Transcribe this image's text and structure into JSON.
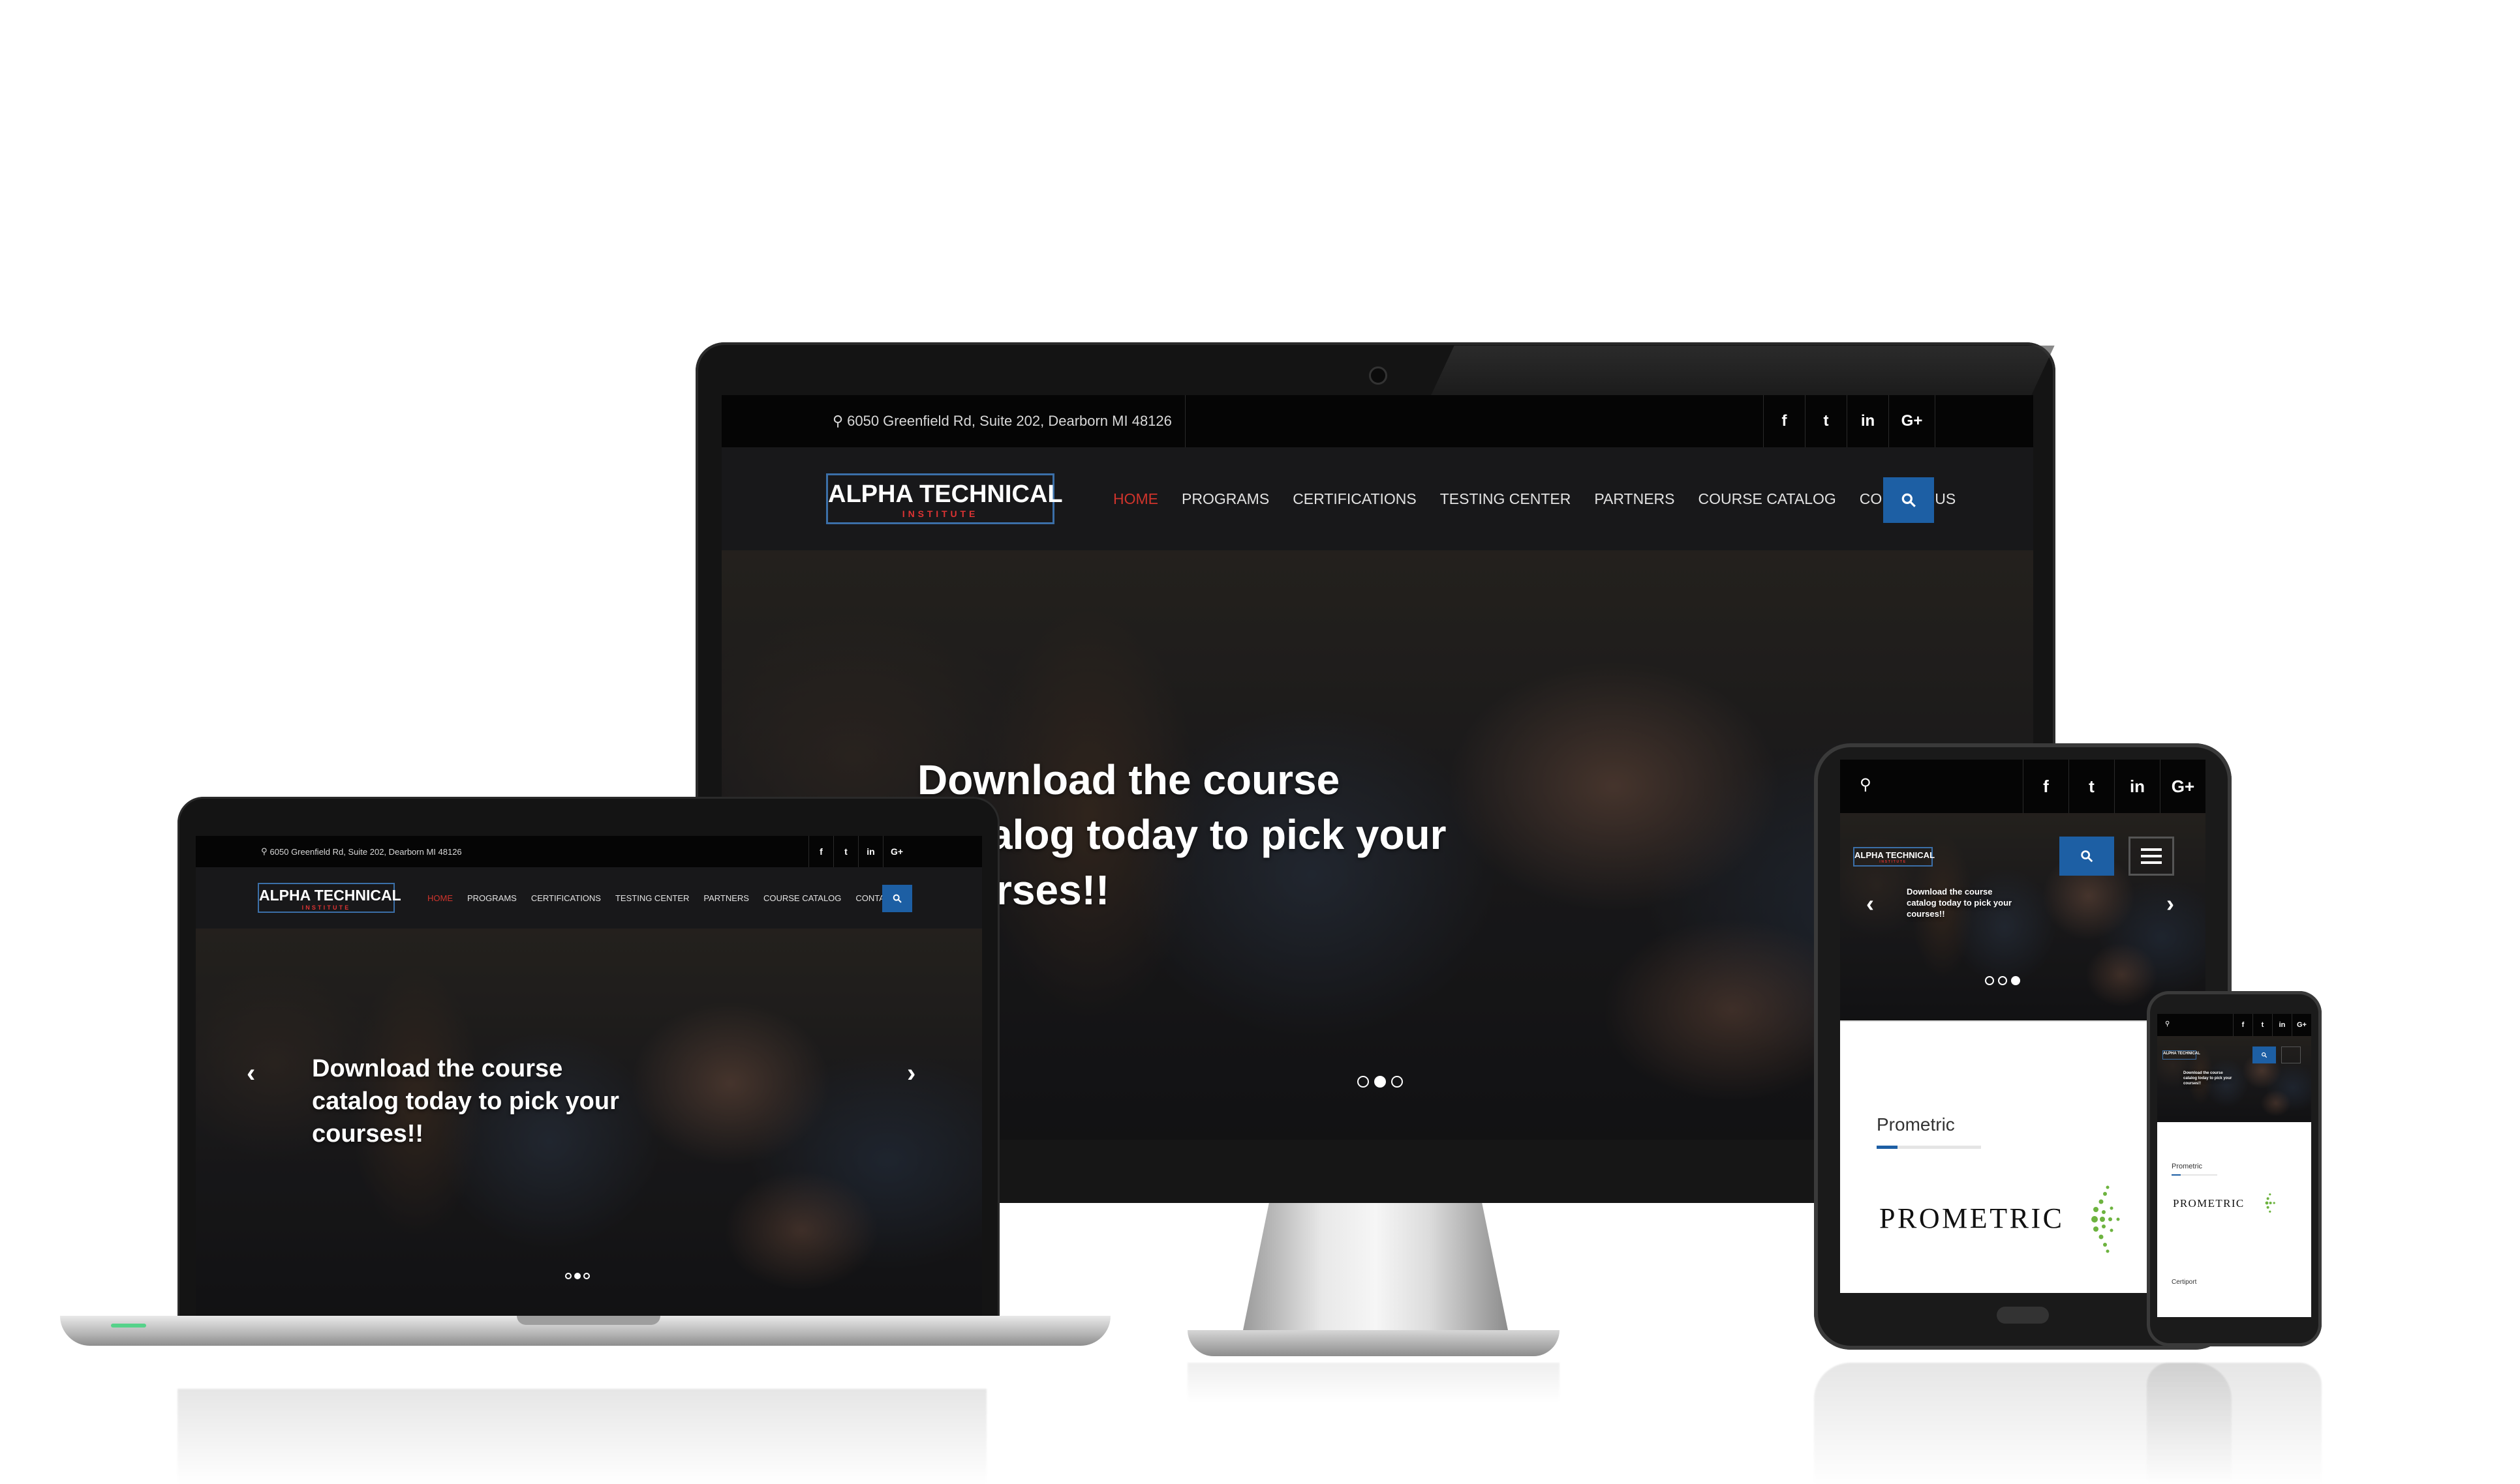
{
  "site": {
    "address": "6050 Greenfield Rd, Suite 202, Dearborn MI 48126",
    "logo_title": "ALPHA TECHNICAL",
    "logo_subtitle": "INSTITUTE",
    "nav": {
      "home": "HOME",
      "programs": "PROGRAMS",
      "certifications": "CERTIFICATIONS",
      "testing_center": "TESTING CENTER",
      "partners": "PARTNERS",
      "course_catalog": "COURSE CATALOG",
      "contact_us": "CONTACT US"
    },
    "social": {
      "facebook": "f",
      "twitter": "t",
      "linkedin": "in",
      "google": "G+"
    },
    "hero": {
      "monitor_line1": "Download the course",
      "monitor_line2": "alog today to pick your",
      "monitor_line3": "rses!!",
      "laptop_line1": "Download the course",
      "laptop_line2": "catalog today to pick your",
      "laptop_line3": "courses!!",
      "tablet_line1": "Download the course",
      "tablet_line2": "catalog today to pick your",
      "tablet_line3": "courses!!"
    },
    "partner_card": {
      "title": "Prometric",
      "logo_text": "PROMETRIC"
    },
    "phone_card": {
      "title": "Prometric",
      "logo_text": "PROMETRIC",
      "second_title": "Certiport"
    }
  },
  "icons": {
    "map_marker": "map-marker-icon",
    "search": "search-icon",
    "menu": "hamburger-menu-icon",
    "prev": "chevron-left-icon",
    "next": "chevron-right-icon"
  },
  "colors": {
    "accent_blue": "#1d5fa4",
    "active_red": "#d0342c",
    "dark_bg": "#050505"
  }
}
